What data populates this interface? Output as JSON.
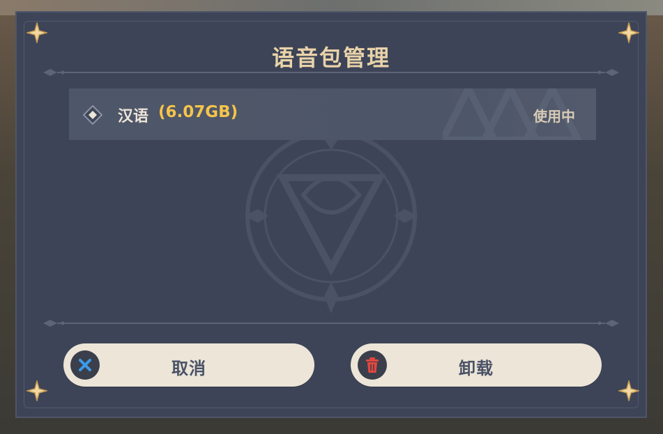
{
  "dialog": {
    "title": "语音包管理"
  },
  "packages": [
    {
      "name": "汉语",
      "size": "(6.07GB)",
      "status": "使用中"
    }
  ],
  "buttons": {
    "cancel_label": "取消",
    "uninstall_label": "卸载"
  },
  "colors": {
    "dialog_bg": "#3d4457",
    "title": "#e9d3a9",
    "size_highlight": "#f5c44a",
    "button_bg": "#ece5d8",
    "cancel_icon": "#3b9be8",
    "uninstall_icon": "#e2473f"
  },
  "icons": {
    "cancel": "close-icon",
    "uninstall": "trash-icon",
    "select": "diamond-radio-icon"
  }
}
